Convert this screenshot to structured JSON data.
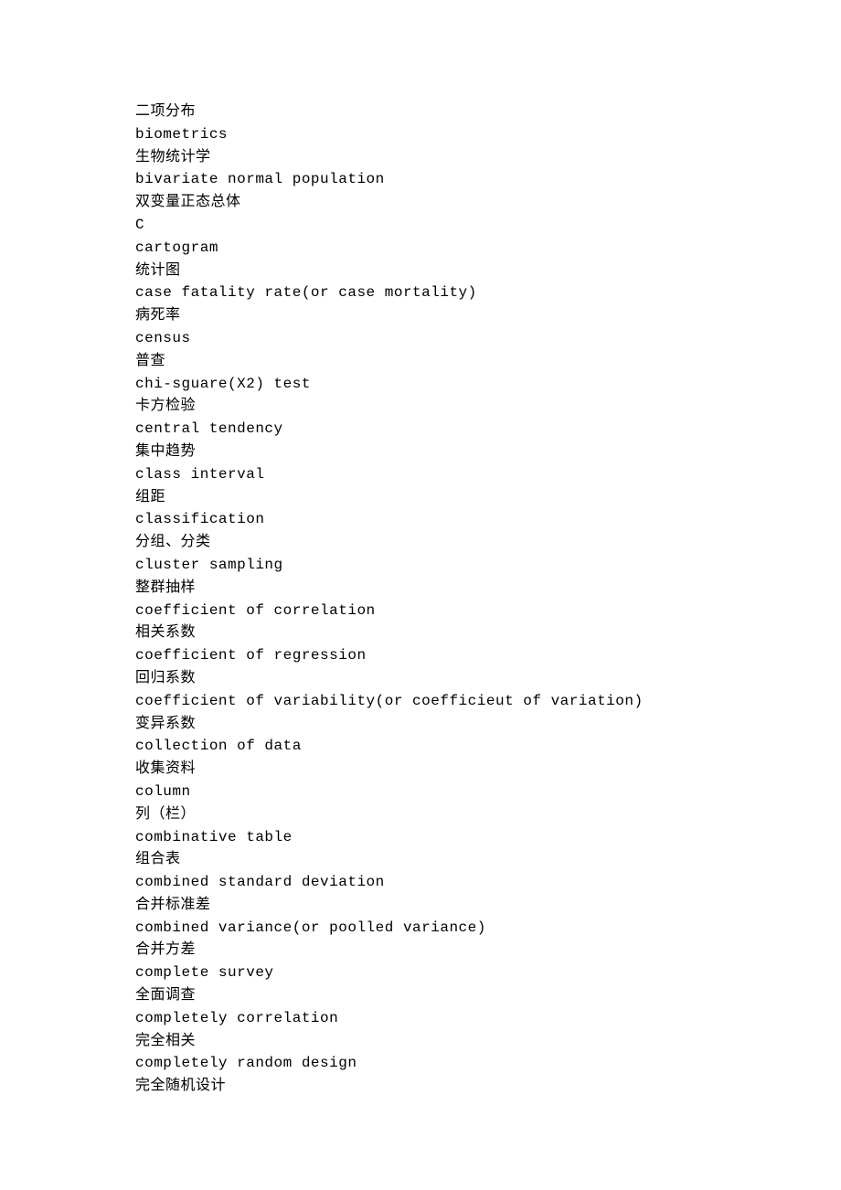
{
  "lines": [
    "二项分布",
    "biometrics",
    "生物统计学",
    "bivariate normal population",
    "双变量正态总体",
    "C",
    "cartogram",
    "统计图",
    "case fatality rate(or case mortality)",
    "病死率",
    "census",
    "普查",
    "chi-sguare(X2) test",
    "卡方检验",
    "central tendency",
    "集中趋势",
    "class interval",
    "组距",
    "classification",
    "分组、分类",
    "cluster sampling",
    "整群抽样",
    "coefficient of correlation",
    "相关系数",
    "coefficient of regression",
    "回归系数",
    "coefficient of variability(or coefficieut of variation)",
    "变异系数",
    "collection of data",
    "收集资料",
    "column",
    "列（栏）",
    "combinative table",
    "组合表",
    "combined standard deviation",
    "合并标准差",
    "combined variance(or poolled variance)",
    "合并方差",
    "complete survey",
    "全面调查",
    "completely correlation",
    "完全相关",
    "completely random design",
    "完全随机设计"
  ]
}
